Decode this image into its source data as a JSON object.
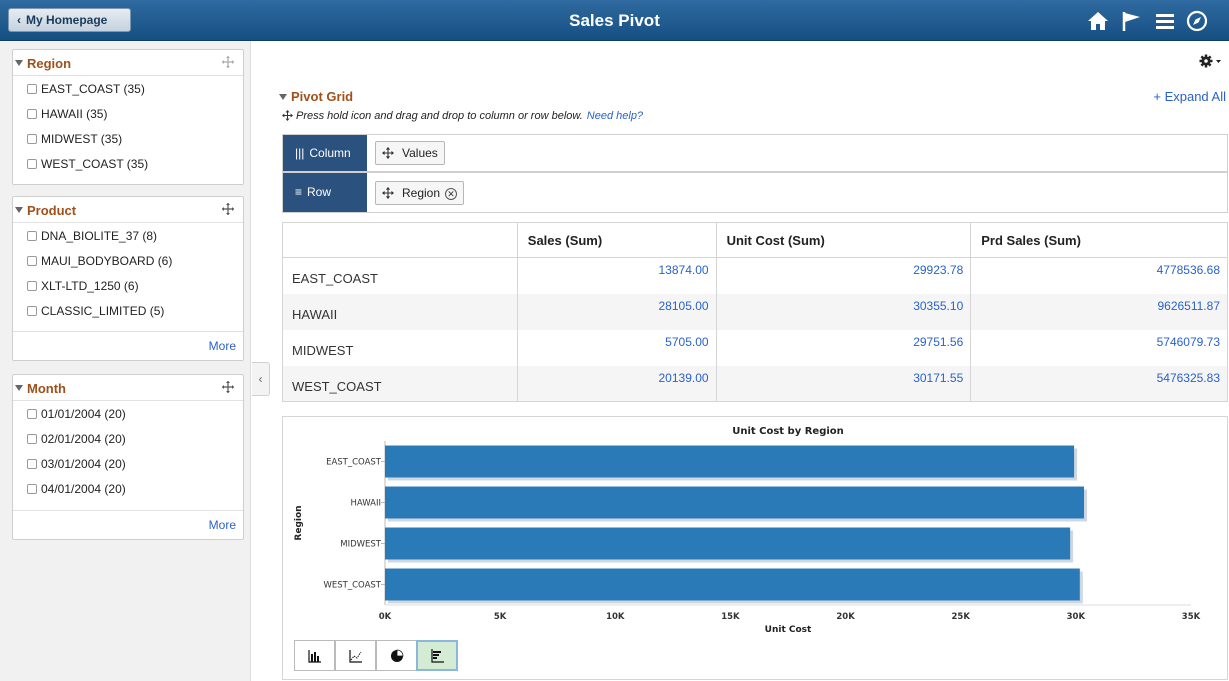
{
  "header": {
    "back_label": "My Homepage",
    "title": "Sales Pivot",
    "icons": [
      "home-icon",
      "flag-icon",
      "menu-icon",
      "compass-icon"
    ]
  },
  "facets": [
    {
      "title": "Region",
      "items": [
        "EAST_COAST (35)",
        "HAWAII (35)",
        "MIDWEST (35)",
        "WEST_COAST (35)"
      ],
      "more": ""
    },
    {
      "title": "Product",
      "items": [
        "DNA_BIOLITE_37 (8)",
        "MAUI_BODYBOARD (6)",
        "XLT-LTD_1250 (6)",
        "CLASSIC_LIMITED (5)"
      ],
      "more": "More"
    },
    {
      "title": "Month",
      "items": [
        "01/01/2004 (20)",
        "02/01/2004 (20)",
        "03/01/2004 (20)",
        "04/01/2004 (20)"
      ],
      "more": "More"
    }
  ],
  "pivot": {
    "title": "Pivot Grid",
    "expand_all": "+ Expand All",
    "instructions": "Press hold icon and drag and drop to column or row below.",
    "help_link": "Need help?",
    "column_label": "Column",
    "row_label": "Row",
    "column_chip": "Values",
    "row_chip": "Region"
  },
  "grid": {
    "headers": [
      "",
      "Sales (Sum)",
      "Unit Cost (Sum)",
      "Prd Sales (Sum)"
    ],
    "rows": [
      {
        "label": "EAST_COAST",
        "sales": "13874.00",
        "unit_cost": "29923.78",
        "prd_sales": "4778536.68"
      },
      {
        "label": "HAWAII",
        "sales": "28105.00",
        "unit_cost": "30355.10",
        "prd_sales": "9626511.87"
      },
      {
        "label": "MIDWEST",
        "sales": "5705.00",
        "unit_cost": "29751.56",
        "prd_sales": "5746079.73"
      },
      {
        "label": "WEST_COAST",
        "sales": "20139.00",
        "unit_cost": "30171.55",
        "prd_sales": "5476325.83"
      }
    ]
  },
  "chart_data": {
    "type": "bar",
    "orientation": "horizontal",
    "title": "Unit Cost by Region",
    "xlabel": "Unit Cost",
    "ylabel": "Region",
    "categories": [
      "EAST_COAST",
      "HAWAII",
      "MIDWEST",
      "WEST_COAST"
    ],
    "values": [
      29923.78,
      30355.1,
      29751.56,
      30171.55
    ],
    "xlim": [
      0,
      35000
    ],
    "ticks": [
      "0K",
      "5K",
      "10K",
      "15K",
      "20K",
      "25K",
      "30K",
      "35K"
    ],
    "bar_color": "#2a7ab8",
    "grid": false,
    "legend": "none"
  },
  "chart_types": [
    "bar-chart-icon",
    "line-chart-icon",
    "pie-chart-icon",
    "horizontal-bar-chart-icon"
  ],
  "selected_chart_type": "horizontal-bar-chart-icon"
}
